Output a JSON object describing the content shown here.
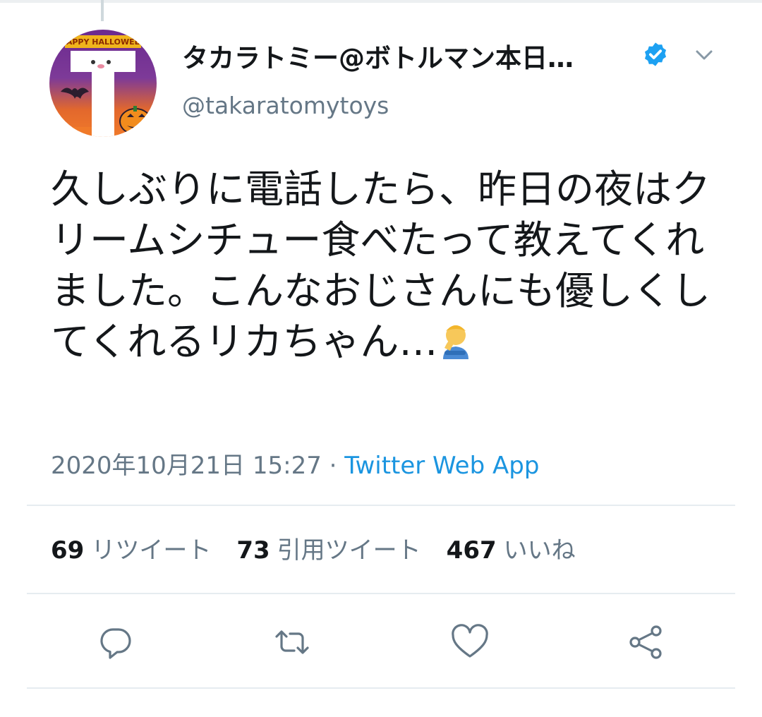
{
  "user": {
    "display_name": "タカラトミー@ボトルマン本日…",
    "handle": "@takaratomytoys",
    "avatar_banner_text": "HAPPY HALLOWEEN",
    "verified": true
  },
  "tweet": {
    "text": "久しぶりに電話したら、昨日の夜はクリームシチュー食べたって教えてくれました。こんなおじさんにも優しくしてくれるリカちゃん…",
    "emoji": "man-facepalming-icon"
  },
  "meta": {
    "timestamp": "2020年10月21日 15:27",
    "separator": "·",
    "source": "Twitter Web App"
  },
  "stats": {
    "retweets": {
      "count": "69",
      "label": "リツイート"
    },
    "quotes": {
      "count": "73",
      "label": "引用ツイート"
    },
    "likes": {
      "count": "467",
      "label": "いいね"
    }
  },
  "actions": [
    {
      "name": "reply-icon"
    },
    {
      "name": "retweet-icon"
    },
    {
      "name": "like-icon"
    },
    {
      "name": "share-icon"
    }
  ],
  "colors": {
    "text": "#14171a",
    "secondary": "#657786",
    "link": "#1b95e0",
    "verified": "#1da1f2",
    "divider": "#e6ecf0"
  }
}
